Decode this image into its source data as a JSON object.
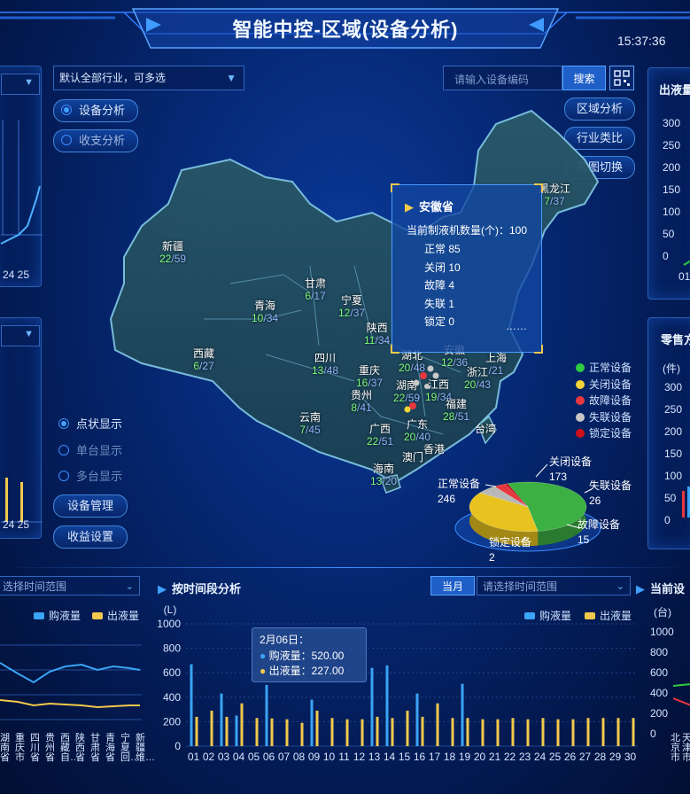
{
  "header": {
    "title": "智能中控-区域(设备分析)",
    "clock": "15:37:36"
  },
  "filters": {
    "industry_select": "默认全部行业，可多选",
    "device_code_placeholder": "请输入设备编码",
    "search_label": "搜索"
  },
  "left_controls": {
    "mode_tabs": [
      {
        "label": "设备分析",
        "selected": true
      },
      {
        "label": "收支分析",
        "selected": false
      }
    ],
    "display_modes": [
      {
        "label": "点状显示",
        "selected": true
      },
      {
        "label": "单台显示",
        "selected": false
      },
      {
        "label": "多台显示",
        "selected": false
      }
    ],
    "device_manage_label": "设备管理",
    "revenue_settings_label": "收益设置"
  },
  "right_controls": {
    "region_analysis": "区域分析",
    "industry_compare": "行业类比",
    "view_switch": "视图切换"
  },
  "left_partial": {
    "top_axis_tail": "24 25",
    "mid_axis_tail": "24 25"
  },
  "right_partial": {
    "top_title": "出液量",
    "top_axis": [
      "300",
      "250",
      "200",
      "150",
      "100",
      "50",
      "0"
    ],
    "top_x": "01",
    "mid_title": "零售方",
    "mid_unit": "(件)",
    "mid_axis": [
      "300",
      "250",
      "200",
      "150",
      "100",
      "50",
      "0"
    ]
  },
  "map": {
    "provinces": [
      {
        "name": "新疆",
        "v": "22",
        "t": "59"
      },
      {
        "name": "西藏",
        "v": "6",
        "t": "27"
      },
      {
        "name": "青海",
        "v": "10",
        "t": "34"
      },
      {
        "name": "甘肃",
        "v": "6",
        "t": "17"
      },
      {
        "name": "宁夏",
        "v": "12",
        "t": "37"
      },
      {
        "name": "四川",
        "v": "13",
        "t": "48"
      },
      {
        "name": "陕西",
        "v": "11",
        "t": "34"
      },
      {
        "name": "重庆",
        "v": "16",
        "t": "37"
      },
      {
        "name": "贵州",
        "v": "8",
        "t": "41"
      },
      {
        "name": "云南",
        "v": "7",
        "t": "45"
      },
      {
        "name": "广西",
        "v": "22",
        "t": "51"
      },
      {
        "name": "湖北",
        "v": "20",
        "t": "48"
      },
      {
        "name": "湖南",
        "v": "22",
        "t": "59"
      },
      {
        "name": "江西",
        "v": "19",
        "t": "34"
      },
      {
        "name": "广东",
        "v": "20",
        "t": "40"
      },
      {
        "name": "福建",
        "v": "28",
        "t": "51"
      },
      {
        "name": "浙江",
        "v": "20",
        "t": "43"
      },
      {
        "name": "上海",
        "v": "",
        "t": "21"
      },
      {
        "name": "安徽",
        "v": "12",
        "t": "36"
      },
      {
        "name": "黑龙江",
        "v": "7",
        "t": "37"
      },
      {
        "name": "海南",
        "v": "13",
        "t": "20"
      }
    ],
    "labels_only": [
      "香港",
      "澳门",
      "台湾"
    ]
  },
  "tooltip_province": {
    "title": "安徽省",
    "total_label": "当前制液机数量(个)：100",
    "rows": [
      "正常 85",
      "关闭 10",
      "故障 4",
      "失联 1",
      "锁定 0"
    ],
    "more": "……"
  },
  "status_legend": [
    {
      "label": "正常设备",
      "color": "#2ecc40"
    },
    {
      "label": "关闭设备",
      "color": "#f2d338"
    },
    {
      "label": "故障设备",
      "color": "#e8383d"
    },
    {
      "label": "失联设备",
      "color": "#c8c8c8"
    },
    {
      "label": "锁定设备",
      "color": "#d0101a"
    }
  ],
  "pie": {
    "slices": [
      {
        "label": "正常设备",
        "value": 246,
        "color": "#3cb043"
      },
      {
        "label": "关闭设备",
        "value": 173,
        "color": "#e8c21e"
      },
      {
        "label": "失联设备",
        "value": 26,
        "color": "#b8b8b8"
      },
      {
        "label": "故障设备",
        "value": 15,
        "color": "#e8383d"
      },
      {
        "label": "锁定设备",
        "value": 2,
        "color": "#c0101a"
      }
    ]
  },
  "bottom_left": {
    "select_placeholder": "选择时间范围",
    "legend": [
      "购液量",
      "出液量"
    ],
    "x_labels": [
      "湖南省",
      "重庆市",
      "四川省",
      "贵州省",
      "西藏自…",
      "陕西省",
      "甘肃省",
      "青海省",
      "宁夏回…",
      "新疆维…"
    ]
  },
  "bottom_center": {
    "title": "按时间段分析",
    "month_tab": "当月",
    "select_placeholder": "请选择时间范围",
    "legend": [
      "购液量",
      "出液量"
    ],
    "tooltip": {
      "date": "2月06日：",
      "buy": "购液量：520.00",
      "sell": "出液量：227.00"
    }
  },
  "bottom_right": {
    "title": "当前设",
    "unit": "(台)",
    "axis": [
      "1000",
      "800",
      "600",
      "400",
      "200",
      "0"
    ],
    "x_labels": [
      "北京市",
      "天津市"
    ]
  },
  "chart_data": {
    "type": "bar",
    "title": "按时间段分析",
    "ylabel": "(L)",
    "ylim": [
      0,
      1000
    ],
    "yticks": [
      0,
      200,
      400,
      600,
      800,
      1000
    ],
    "categories": [
      "01",
      "02",
      "03",
      "04",
      "05",
      "06",
      "07",
      "08",
      "09",
      "10",
      "11",
      "12",
      "13",
      "14",
      "15",
      "16",
      "17",
      "18",
      "19",
      "20",
      "21",
      "22",
      "23",
      "24",
      "25",
      "26",
      "27",
      "28",
      "29",
      "30"
    ],
    "series": [
      {
        "name": "购液量",
        "color": "#3aa4f5",
        "values": [
          670,
          0,
          430,
          250,
          0,
          500,
          0,
          0,
          380,
          0,
          0,
          0,
          640,
          660,
          0,
          430,
          0,
          0,
          510,
          0,
          0,
          0,
          0,
          0,
          0,
          0,
          0,
          0,
          0,
          0
        ]
      },
      {
        "name": "出液量",
        "color": "#f2c94c",
        "values": [
          240,
          290,
          240,
          350,
          230,
          227,
          220,
          190,
          290,
          230,
          220,
          220,
          240,
          230,
          290,
          240,
          350,
          230,
          230,
          220,
          220,
          230,
          220,
          230,
          220,
          220,
          230,
          230,
          230,
          230
        ]
      }
    ]
  }
}
